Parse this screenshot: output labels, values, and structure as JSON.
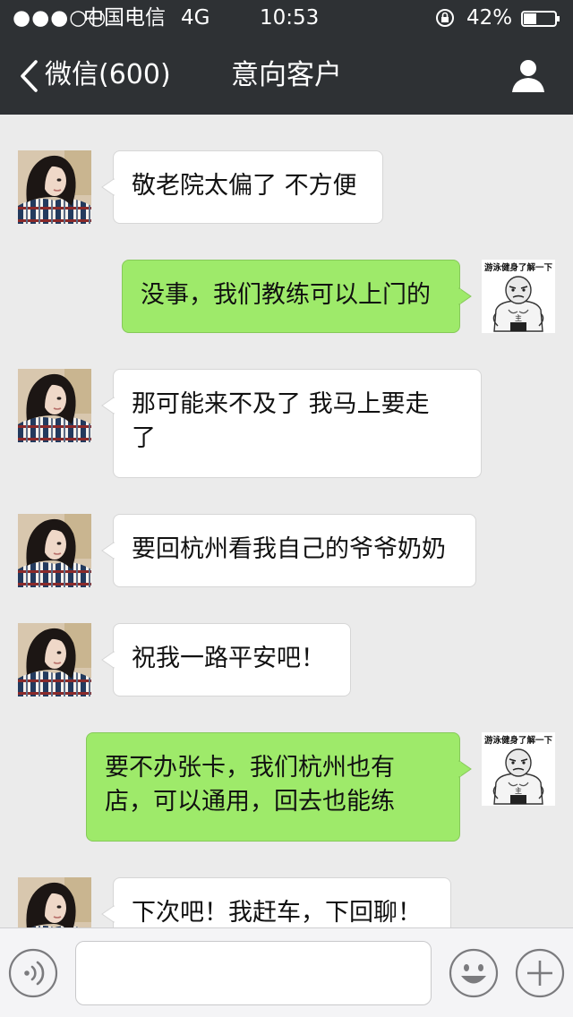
{
  "status_bar": {
    "signal": "●●●○○",
    "carrier": "中国电信",
    "network": "4G",
    "time": "10:53",
    "battery_percent": "42%",
    "battery_level": 0.42
  },
  "nav": {
    "back_label": "微信(600)",
    "title": "意向客户"
  },
  "messages": [
    {
      "side": "left",
      "text": "敬老院太偏了 不方便"
    },
    {
      "side": "right",
      "text": "没事，我们教练可以上门的",
      "avatar_caption": "游泳健身了解一下"
    },
    {
      "side": "left",
      "text": "那可能来不及了 我马上要走\n了"
    },
    {
      "side": "left",
      "text": "要回杭州看我自己的爷爷奶奶"
    },
    {
      "side": "left",
      "text": "祝我一路平安吧！"
    },
    {
      "side": "right",
      "text": "要不办张卡，我们杭州也有\n店，可以通用，回去也能练",
      "avatar_caption": "游泳健身了解一下"
    },
    {
      "side": "left",
      "text": "下次吧！我赶车，下回聊！"
    }
  ],
  "input_bar": {
    "placeholder": "",
    "voice_icon": "voice-icon",
    "emoji_icon": "emoji-icon",
    "add_icon": "plus-icon"
  },
  "colors": {
    "nav_bg": "#2e3134",
    "chat_bg": "#ebebeb",
    "bubble_out": "#9eea6a",
    "bubble_in": "#ffffff"
  }
}
